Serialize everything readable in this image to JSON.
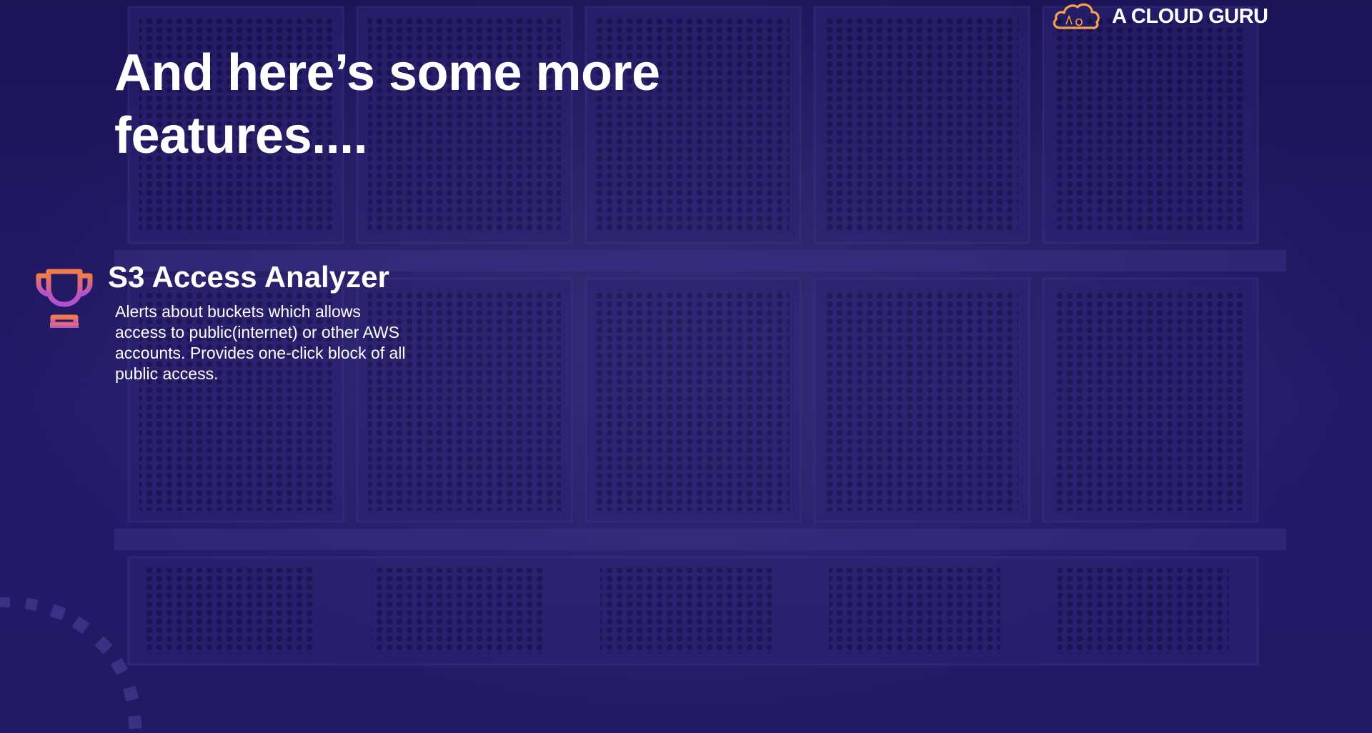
{
  "brand": {
    "name": "A CLOUD GURU",
    "icon": "cloud-logo-icon",
    "accent_color": "#f5a04a"
  },
  "slide": {
    "title": "And here’s some more features....",
    "background_color": "#1f1660"
  },
  "features": [
    {
      "icon": "trophy-icon",
      "title": "S3 Access Analyzer",
      "description": "Alerts about buckets which allows access to public(internet) or other AWS accounts. Provides one-click block of all public access."
    }
  ],
  "colors": {
    "trophy_top": "#f47a4a",
    "trophy_bottom": "#b04fd8",
    "text": "#ffffff"
  }
}
